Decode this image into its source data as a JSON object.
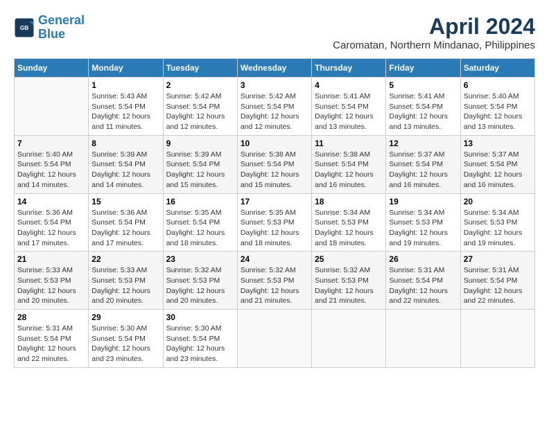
{
  "header": {
    "logo_line1": "General",
    "logo_line2": "Blue",
    "month_title": "April 2024",
    "location": "Caromatan, Northern Mindanao, Philippines"
  },
  "weekdays": [
    "Sunday",
    "Monday",
    "Tuesday",
    "Wednesday",
    "Thursday",
    "Friday",
    "Saturday"
  ],
  "weeks": [
    [
      {
        "day": "",
        "empty": true
      },
      {
        "day": "1",
        "sunrise": "5:43 AM",
        "sunset": "5:54 PM",
        "daylight": "12 hours and 11 minutes."
      },
      {
        "day": "2",
        "sunrise": "5:42 AM",
        "sunset": "5:54 PM",
        "daylight": "12 hours and 12 minutes."
      },
      {
        "day": "3",
        "sunrise": "5:42 AM",
        "sunset": "5:54 PM",
        "daylight": "12 hours and 12 minutes."
      },
      {
        "day": "4",
        "sunrise": "5:41 AM",
        "sunset": "5:54 PM",
        "daylight": "12 hours and 13 minutes."
      },
      {
        "day": "5",
        "sunrise": "5:41 AM",
        "sunset": "5:54 PM",
        "daylight": "12 hours and 13 minutes."
      },
      {
        "day": "6",
        "sunrise": "5:40 AM",
        "sunset": "5:54 PM",
        "daylight": "12 hours and 13 minutes."
      }
    ],
    [
      {
        "day": "7",
        "sunrise": "5:40 AM",
        "sunset": "5:54 PM",
        "daylight": "12 hours and 14 minutes."
      },
      {
        "day": "8",
        "sunrise": "5:39 AM",
        "sunset": "5:54 PM",
        "daylight": "12 hours and 14 minutes."
      },
      {
        "day": "9",
        "sunrise": "5:39 AM",
        "sunset": "5:54 PM",
        "daylight": "12 hours and 15 minutes."
      },
      {
        "day": "10",
        "sunrise": "5:38 AM",
        "sunset": "5:54 PM",
        "daylight": "12 hours and 15 minutes."
      },
      {
        "day": "11",
        "sunrise": "5:38 AM",
        "sunset": "5:54 PM",
        "daylight": "12 hours and 16 minutes."
      },
      {
        "day": "12",
        "sunrise": "5:37 AM",
        "sunset": "5:54 PM",
        "daylight": "12 hours and 16 minutes."
      },
      {
        "day": "13",
        "sunrise": "5:37 AM",
        "sunset": "5:54 PM",
        "daylight": "12 hours and 16 minutes."
      }
    ],
    [
      {
        "day": "14",
        "sunrise": "5:36 AM",
        "sunset": "5:54 PM",
        "daylight": "12 hours and 17 minutes."
      },
      {
        "day": "15",
        "sunrise": "5:36 AM",
        "sunset": "5:54 PM",
        "daylight": "12 hours and 17 minutes."
      },
      {
        "day": "16",
        "sunrise": "5:35 AM",
        "sunset": "5:54 PM",
        "daylight": "12 hours and 18 minutes."
      },
      {
        "day": "17",
        "sunrise": "5:35 AM",
        "sunset": "5:53 PM",
        "daylight": "12 hours and 18 minutes."
      },
      {
        "day": "18",
        "sunrise": "5:34 AM",
        "sunset": "5:53 PM",
        "daylight": "12 hours and 18 minutes."
      },
      {
        "day": "19",
        "sunrise": "5:34 AM",
        "sunset": "5:53 PM",
        "daylight": "12 hours and 19 minutes."
      },
      {
        "day": "20",
        "sunrise": "5:34 AM",
        "sunset": "5:53 PM",
        "daylight": "12 hours and 19 minutes."
      }
    ],
    [
      {
        "day": "21",
        "sunrise": "5:33 AM",
        "sunset": "5:53 PM",
        "daylight": "12 hours and 20 minutes."
      },
      {
        "day": "22",
        "sunrise": "5:33 AM",
        "sunset": "5:53 PM",
        "daylight": "12 hours and 20 minutes."
      },
      {
        "day": "23",
        "sunrise": "5:32 AM",
        "sunset": "5:53 PM",
        "daylight": "12 hours and 20 minutes."
      },
      {
        "day": "24",
        "sunrise": "5:32 AM",
        "sunset": "5:53 PM",
        "daylight": "12 hours and 21 minutes."
      },
      {
        "day": "25",
        "sunrise": "5:32 AM",
        "sunset": "5:53 PM",
        "daylight": "12 hours and 21 minutes."
      },
      {
        "day": "26",
        "sunrise": "5:31 AM",
        "sunset": "5:54 PM",
        "daylight": "12 hours and 22 minutes."
      },
      {
        "day": "27",
        "sunrise": "5:31 AM",
        "sunset": "5:54 PM",
        "daylight": "12 hours and 22 minutes."
      }
    ],
    [
      {
        "day": "28",
        "sunrise": "5:31 AM",
        "sunset": "5:54 PM",
        "daylight": "12 hours and 22 minutes."
      },
      {
        "day": "29",
        "sunrise": "5:30 AM",
        "sunset": "5:54 PM",
        "daylight": "12 hours and 23 minutes."
      },
      {
        "day": "30",
        "sunrise": "5:30 AM",
        "sunset": "5:54 PM",
        "daylight": "12 hours and 23 minutes."
      },
      {
        "day": "",
        "empty": true
      },
      {
        "day": "",
        "empty": true
      },
      {
        "day": "",
        "empty": true
      },
      {
        "day": "",
        "empty": true
      }
    ]
  ]
}
